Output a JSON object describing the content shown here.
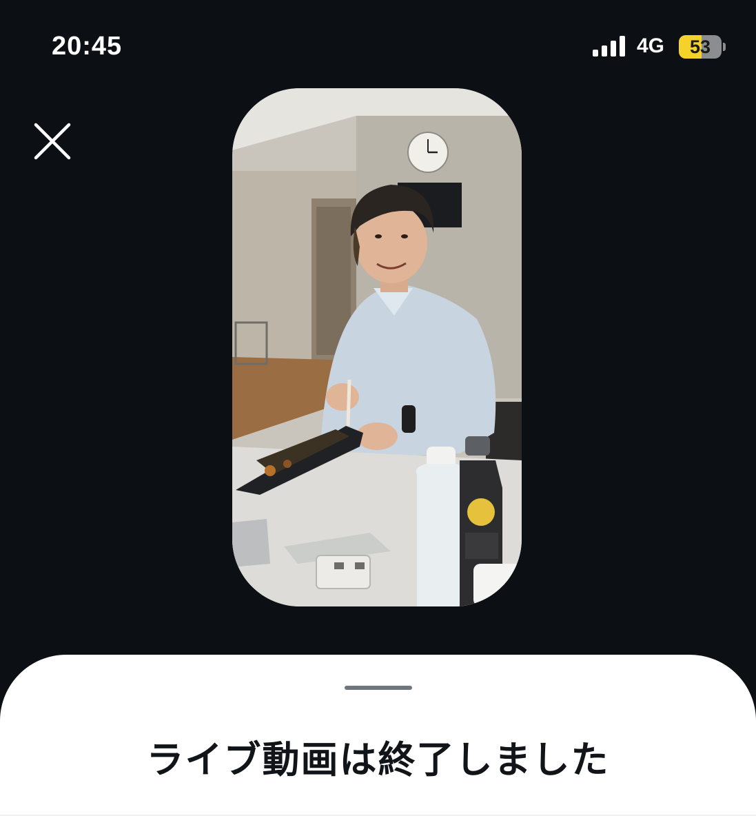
{
  "status_bar": {
    "time": "20:45",
    "network": "4G",
    "battery_level": "53",
    "battery_fraction": 0.53,
    "signal_icon": "cellular-signal-icon",
    "battery_icon": "battery-icon"
  },
  "player": {
    "close_icon": "close-icon",
    "video_description_icon": "video-thumbnail"
  },
  "sheet": {
    "title": "ライブ動画は終了しました"
  },
  "colors": {
    "background": "#0c1015",
    "sheet": "#ffffff",
    "handle": "#6e7680",
    "battery_fill": "#f4d22a",
    "battery_empty": "#8b8d90",
    "title_text": "#111418"
  }
}
